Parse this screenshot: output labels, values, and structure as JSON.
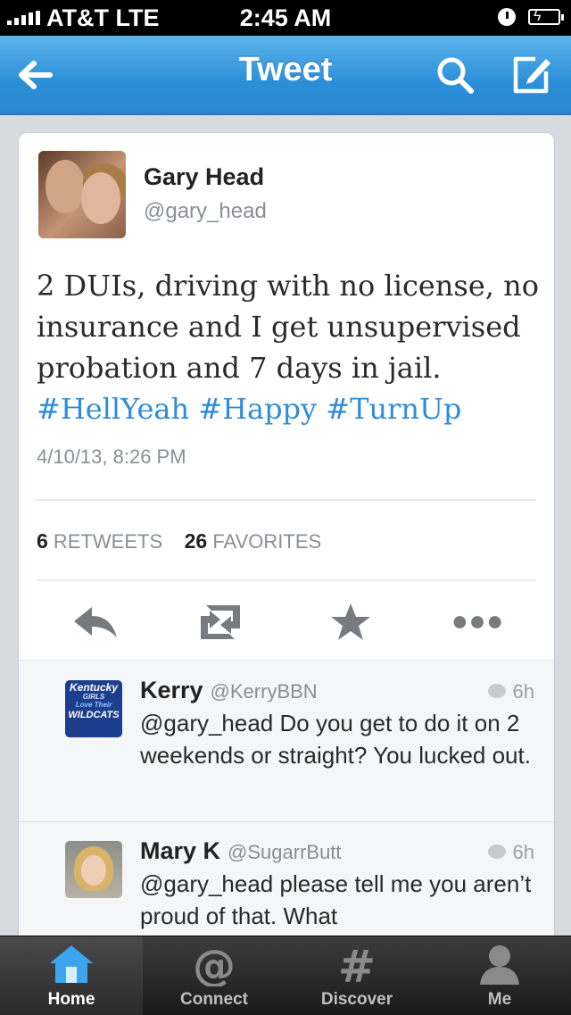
{
  "status_bar": {
    "carrier": "AT&T  LTE",
    "time": "2:45 AM"
  },
  "nav": {
    "title": "Tweet"
  },
  "tweet": {
    "author_name": "Gary Head",
    "author_handle": "@gary_head",
    "text_plain": "2 DUIs, driving with no license, no insurance and I get unsupervised probation and 7 days in jail.",
    "hashtags": [
      "#HellYeah",
      "#Happy",
      "#TurnUp"
    ],
    "timestamp": "4/10/13, 8:26 PM",
    "retweet_count": "6",
    "retweet_label": "RETWEETS",
    "favorite_count": "26",
    "favorite_label": "FAVORITES"
  },
  "replies": [
    {
      "name": "Kerry",
      "handle": "@KerryBBN",
      "time": "6h",
      "text": "@gary_head Do you get to do it on 2 weekends or straight? You lucked out.",
      "avatar_text": [
        "Kentucky",
        "GIRLS",
        "Love",
        "Their",
        "WILDCATS"
      ]
    },
    {
      "name": "Mary K",
      "handle": "@SugarrButt",
      "time": "6h",
      "text": "@gary_head please tell me you aren’t proud of that. What"
    }
  ],
  "tab_bar": {
    "items": [
      {
        "label": "Home",
        "icon": "home-icon",
        "active": true
      },
      {
        "label": "Connect",
        "icon": "at-sign-icon",
        "active": false
      },
      {
        "label": "Discover",
        "icon": "hash-icon",
        "active": false
      },
      {
        "label": "Me",
        "icon": "person-icon",
        "active": false
      }
    ]
  },
  "colors": {
    "nav_blue": "#2b8fd8",
    "hashtag_blue": "#2e8dd8",
    "tab_bar": "#1a1a1a"
  }
}
